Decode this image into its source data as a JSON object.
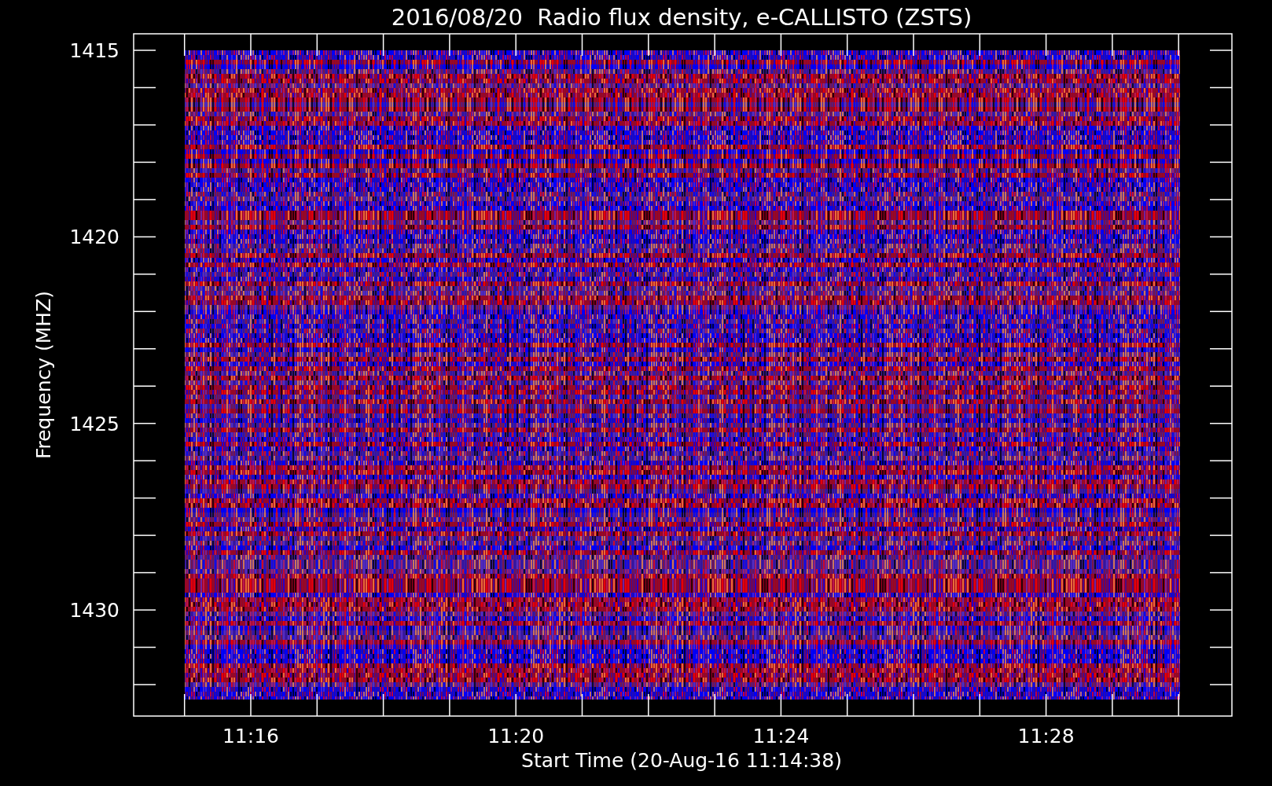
{
  "title": "2016/08/20  Radio flux density, e-CALLISTO (ZSTS)",
  "y_axis": {
    "label": "Frequency (MHZ)",
    "tick_labels": [
      "1415",
      "1420",
      "1425",
      "1430"
    ]
  },
  "x_axis": {
    "label": "Start Time (20-Aug-16 11:14:38)",
    "tick_labels": [
      "11:16",
      "11:20",
      "11:24",
      "11:28"
    ]
  }
}
